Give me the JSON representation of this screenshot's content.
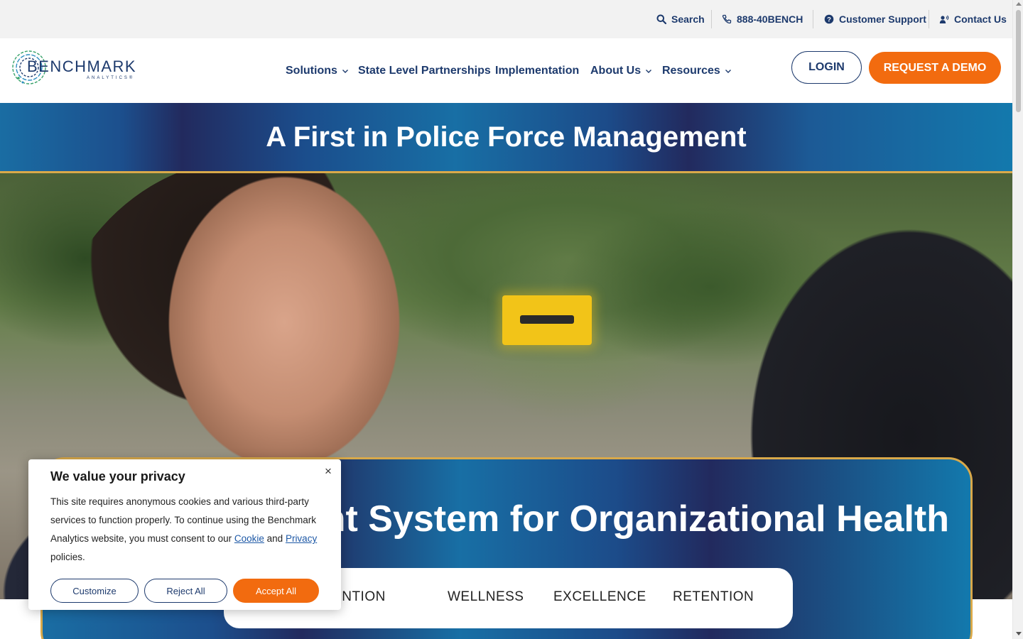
{
  "utility_bar": {
    "search_label": "Search",
    "phone_label": "888-40BENCH",
    "support_label": "Customer Support",
    "contact_label": "Contact Us"
  },
  "logo": {
    "wordmark": "BENCHMARK",
    "subtext": "ANALYTICS®"
  },
  "nav": {
    "items": [
      {
        "label": "Solutions",
        "has_dropdown": true
      },
      {
        "label": "State Level Partnerships",
        "has_dropdown": false
      },
      {
        "label": "Implementation",
        "has_dropdown": false
      },
      {
        "label": "About Us",
        "has_dropdown": true
      },
      {
        "label": "Resources",
        "has_dropdown": true
      }
    ],
    "login_label": "LOGIN",
    "demo_label": "REQUEST A DEMO"
  },
  "banner": {
    "headline": "A First in Police Force Management"
  },
  "card": {
    "heading_visible": "nent System for Organizational Health",
    "tabs": [
      "RVENTION",
      "WELLNESS",
      "EXCELLENCE",
      "RETENTION"
    ]
  },
  "cookie": {
    "title": "We value your privacy",
    "close_glyph": "×",
    "text_before": "This site requires anonymous cookies and various third-party services to function properly. To continue using the Benchmark Analytics website, you must consent to our ",
    "cookie_link": "Cookie",
    "text_and": " and ",
    "privacy_link": "Privacy",
    "text_after": " policies.",
    "customize_label": "Customize",
    "reject_label": "Reject All",
    "accept_label": "Accept All"
  },
  "colors": {
    "brand_navy": "#1d3a6d",
    "accent_orange": "#f26b0f",
    "gold_border": "#d9a94a"
  }
}
